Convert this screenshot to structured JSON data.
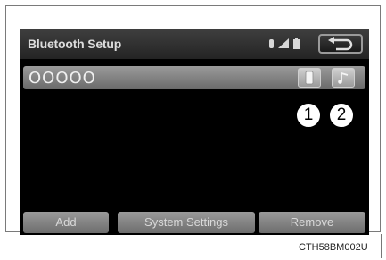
{
  "header": {
    "title": "Bluetooth Setup",
    "icons": [
      "bluetooth-icon",
      "signal-strength-icon",
      "battery-icon"
    ],
    "back_icon": "back-arrow-icon"
  },
  "device": {
    "name": "OOOOO",
    "phone_icon": "phone-icon",
    "music_icon": "music-note-icon"
  },
  "callouts": [
    "1",
    "2"
  ],
  "footer": {
    "add_label": "Add",
    "system_settings_label": "System Settings",
    "remove_label": "Remove"
  },
  "caption": "CTH58BM002U",
  "colors": {
    "screen_bg": "#000000",
    "header_bg": "#2e2e2e",
    "button_gray": "#8a8a8a",
    "text_light": "#dcdcdc"
  }
}
